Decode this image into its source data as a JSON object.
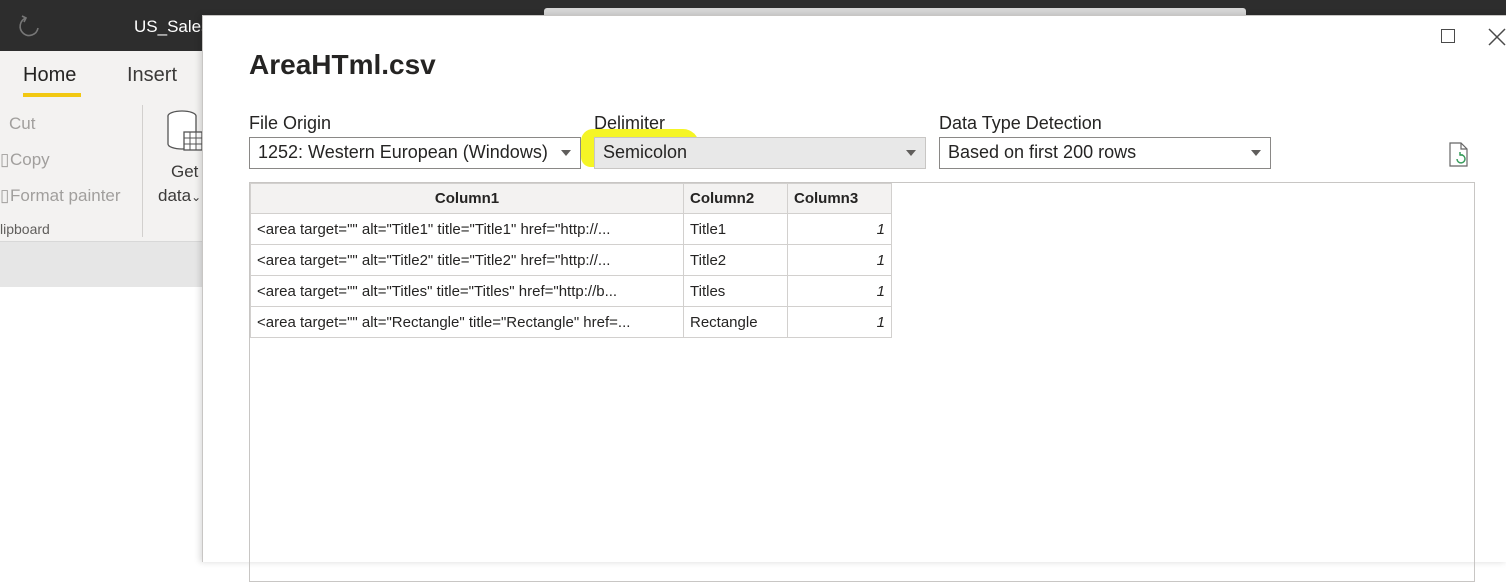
{
  "app": {
    "title": "US_Sales",
    "tabs": [
      {
        "label": "Home"
      },
      {
        "label": "Insert"
      }
    ],
    "clipboard": {
      "cut_label": "Cut",
      "copy_label": "Copy",
      "format_painter_label": "Format painter",
      "group_label": "lipboard"
    },
    "get_data": {
      "line1": "Get",
      "line2": "data"
    }
  },
  "dialog": {
    "title": "AreaHTml.csv",
    "file_origin": {
      "label": "File Origin",
      "value": "1252: Western European (Windows)"
    },
    "delimiter": {
      "label": "Delimiter",
      "value": "Semicolon",
      "highlight_color": "#f4f41a"
    },
    "data_type_detection": {
      "label": "Data Type Detection",
      "value": "Based on first 200 rows"
    },
    "table": {
      "columns": [
        "Column1",
        "Column2",
        "Column3"
      ],
      "rows": [
        [
          "<area target=\"\" alt=\"Title1\" title=\"Title1\" href=\"http://...",
          "Title1",
          "1"
        ],
        [
          "<area target=\"\" alt=\"Title2\" title=\"Title2\" href=\"http://...",
          "Title2",
          "1"
        ],
        [
          "<area target=\"\" alt=\"Titles\" title=\"Titles\" href=\"http://b...",
          "Titles",
          "1"
        ],
        [
          "<area target=\"\" alt=\"Rectangle\" title=\"Rectangle\" href=...",
          "Rectangle",
          "1"
        ]
      ]
    }
  },
  "icons": [
    "redo-icon",
    "cut-icon",
    "copy-icon",
    "format-painter-icon",
    "database-icon",
    "maximize-icon",
    "close-icon",
    "refresh-icon"
  ]
}
